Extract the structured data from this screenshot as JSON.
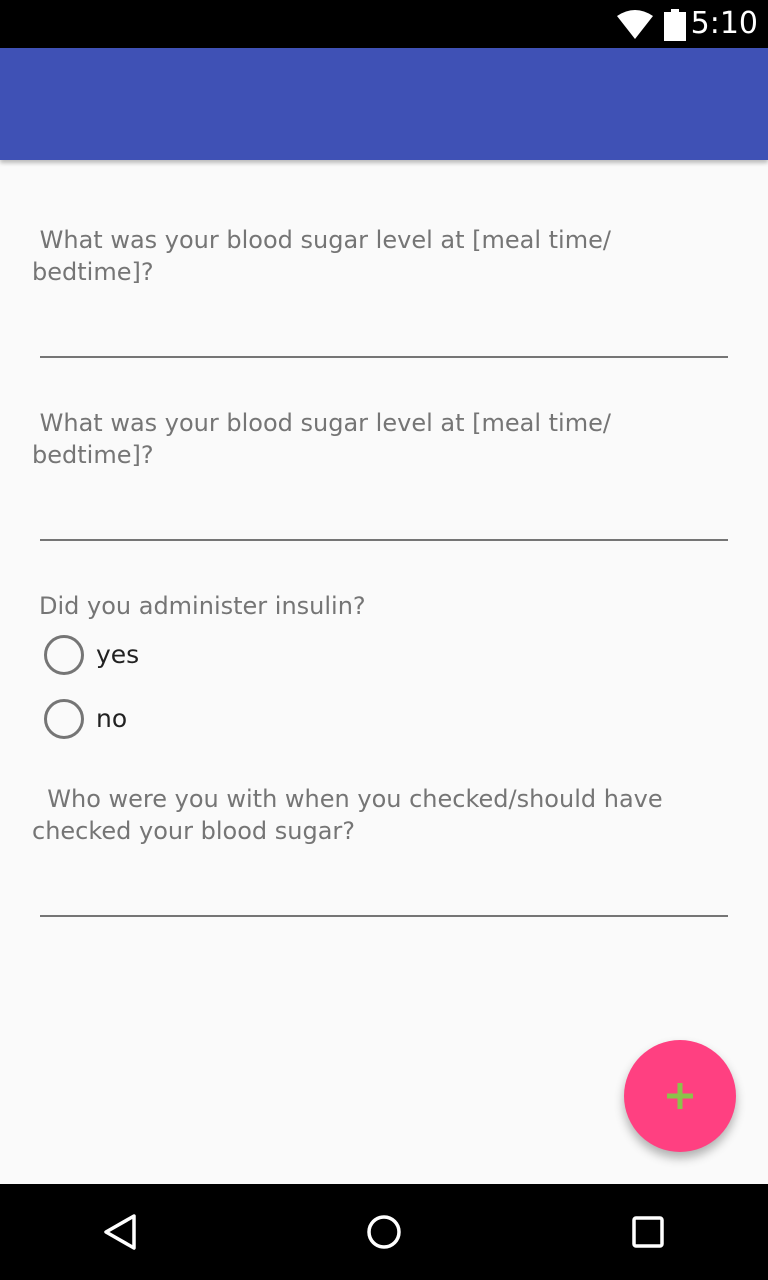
{
  "status_bar": {
    "time": "5:10",
    "icons": [
      "wifi-icon",
      "battery-icon"
    ]
  },
  "app_bar": {
    "color": "#3f51b5"
  },
  "form": {
    "question_1": {
      "label": " What was your blood sugar level at [meal time/\nbedtime]?",
      "value": ""
    },
    "question_2": {
      "label": " What was your blood sugar level at [meal time/\nbedtime]?",
      "value": ""
    },
    "question_3": {
      "label": "Did you administer insulin?",
      "options": [
        "yes",
        "no"
      ]
    },
    "question_4": {
      "label": "  Who were you with when you checked/should have\nchecked your blood sugar?",
      "value": ""
    }
  },
  "fab": {
    "icon": "plus-icon",
    "color": "#ff4081",
    "icon_color": "#8bc34a"
  },
  "nav_bar": {
    "icons": [
      "back-icon",
      "home-icon",
      "recents-icon"
    ]
  }
}
